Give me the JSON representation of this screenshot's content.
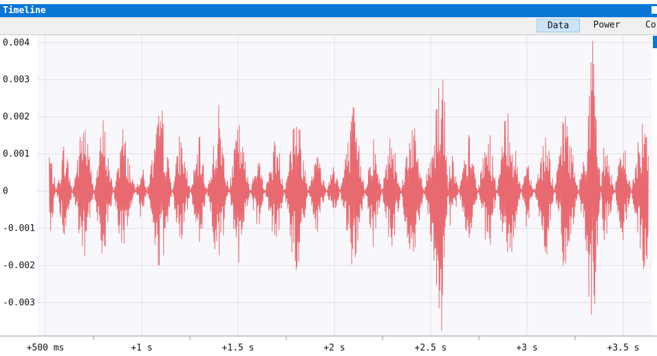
{
  "window": {
    "title": "Timeline"
  },
  "tabs": [
    {
      "label": "Data",
      "active": true
    },
    {
      "label": "Power",
      "active": false
    },
    {
      "label": "Co",
      "active": false
    }
  ],
  "chart_data": {
    "type": "line",
    "color": "#e8696f",
    "ylim": [
      -0.0039,
      0.0042
    ],
    "xlim": [
      500,
      3650
    ],
    "y_ticks": [
      {
        "value": 0.004,
        "label": "0.004"
      },
      {
        "value": 0.003,
        "label": "0.003"
      },
      {
        "value": 0.002,
        "label": "0.002"
      },
      {
        "value": 0.001,
        "label": "0.001"
      },
      {
        "value": 0,
        "label": "0"
      },
      {
        "value": -0.001,
        "label": "-0.001"
      },
      {
        "value": -0.002,
        "label": "-0.002"
      },
      {
        "value": -0.003,
        "label": "-0.003"
      }
    ],
    "x_ticks": [
      {
        "value": 500,
        "label": "+500 ms"
      },
      {
        "value": 1000,
        "label": "+1 s"
      },
      {
        "value": 1500,
        "label": "+1.5 s"
      },
      {
        "value": 2000,
        "label": "+2 s"
      },
      {
        "value": 2500,
        "label": "+2.5 s"
      },
      {
        "value": 3000,
        "label": "+3 s"
      },
      {
        "value": 3500,
        "label": "+3.5 s"
      }
    ],
    "grid": true,
    "series": [
      {
        "x": [
          520,
          600,
          700,
          800,
          900,
          1000,
          1100,
          1200,
          1300,
          1400,
          1500,
          1600,
          1700,
          1800,
          1900,
          2000,
          2100,
          2200,
          2300,
          2400,
          2500,
          2560,
          2600,
          2700,
          2800,
          2900,
          3000,
          3100,
          3200,
          3300,
          3340,
          3400,
          3500,
          3600
        ],
        "y": [
          0.0012,
          -0.0014,
          0.0021,
          -0.0019,
          0.0017,
          -0.0008,
          0.0023,
          -0.0016,
          0.0014,
          -0.0022,
          0.0019,
          -0.0011,
          0.0016,
          -0.0024,
          0.0013,
          -0.0009,
          0.0022,
          -0.0015,
          0.0018,
          -0.0021,
          0.0011,
          0.0039,
          -0.0013,
          0.0015,
          -0.0018,
          0.0024,
          -0.001,
          0.0017,
          -0.0023,
          0.0012,
          0.004,
          -0.0016,
          0.0014,
          -0.002
        ]
      }
    ]
  }
}
